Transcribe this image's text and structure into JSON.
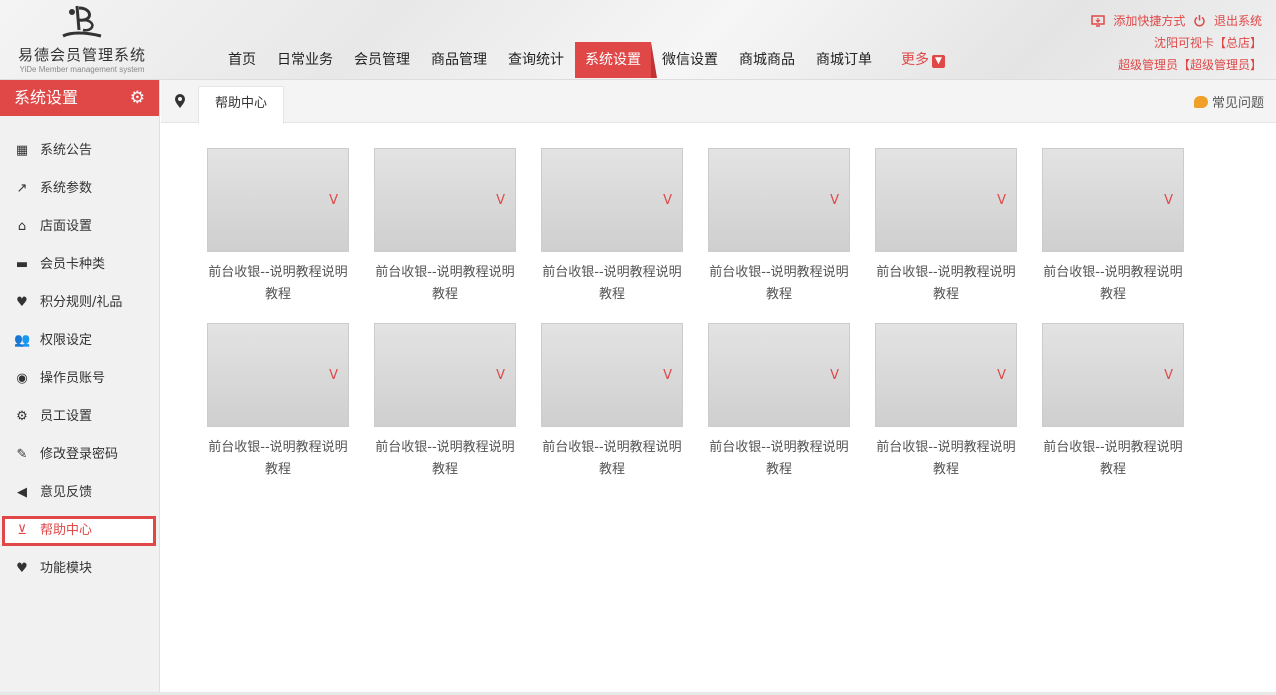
{
  "logo": {
    "title": "易德会员管理系统",
    "subtitle": "YiDe Member management system"
  },
  "nav": [
    {
      "label": "首页"
    },
    {
      "label": "日常业务"
    },
    {
      "label": "会员管理"
    },
    {
      "label": "商品管理"
    },
    {
      "label": "查询统计"
    },
    {
      "label": "系统设置",
      "active": true
    },
    {
      "label": "微信设置"
    },
    {
      "label": "商城商品"
    },
    {
      "label": "商城订单"
    }
  ],
  "nav_more": "更多",
  "top_right": {
    "shortcut": "添加快捷方式",
    "logout": "退出系统",
    "store": "沈阳可视卡【总店】",
    "user": "超级管理员【超级管理员】"
  },
  "sidebar": {
    "title": "系统设置",
    "items": [
      {
        "label": "系统公告",
        "icon": "calendar-icon"
      },
      {
        "label": "系统参数",
        "icon": "chart-icon"
      },
      {
        "label": "店面设置",
        "icon": "home-icon"
      },
      {
        "label": "会员卡种类",
        "icon": "card-icon"
      },
      {
        "label": "积分规则/礼品",
        "icon": "heart-icon"
      },
      {
        "label": "权限设定",
        "icon": "users-icon"
      },
      {
        "label": "操作员账号",
        "icon": "user-circle-icon"
      },
      {
        "label": "员工设置",
        "icon": "gear-icon"
      },
      {
        "label": "修改登录密码",
        "icon": "edit-icon"
      },
      {
        "label": "意见反馈",
        "icon": "speaker-icon"
      },
      {
        "label": "帮助中心",
        "icon": "basket-icon",
        "active": true
      },
      {
        "label": "功能模块",
        "icon": "heart-icon"
      }
    ]
  },
  "tabs": {
    "current": "帮助中心",
    "faq": "常见问题"
  },
  "help_items": [
    {
      "title": "前台收银--说明教程说明教程"
    },
    {
      "title": "前台收银--说明教程说明教程"
    },
    {
      "title": "前台收银--说明教程说明教程"
    },
    {
      "title": "前台收银--说明教程说明教程"
    },
    {
      "title": "前台收银--说明教程说明教程"
    },
    {
      "title": "前台收银--说明教程说明教程"
    },
    {
      "title": "前台收银--说明教程说明教程"
    },
    {
      "title": "前台收银--说明教程说明教程"
    },
    {
      "title": "前台收银--说明教程说明教程"
    },
    {
      "title": "前台收银--说明教程说明教程"
    },
    {
      "title": "前台收银--说明教程说明教程"
    },
    {
      "title": "前台收银--说明教程说明教程"
    }
  ],
  "colors": {
    "accent": "#e04848",
    "sidebar_bg": "#f1f1f1"
  }
}
